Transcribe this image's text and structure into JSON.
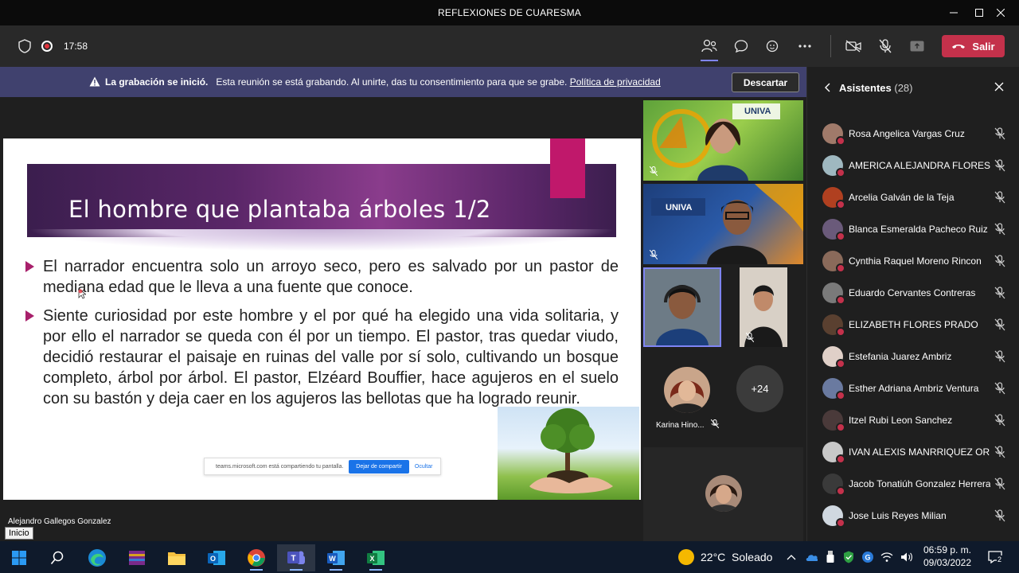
{
  "window": {
    "title": "REFLEXIONES DE CUARESMA",
    "minimize_icon": "minimize-icon",
    "maximize_icon": "maximize-icon",
    "close_icon": "close-icon"
  },
  "toolbar": {
    "timer": "17:58",
    "leave_label": "Salir",
    "colors": {
      "leave": "#c4314b",
      "active": "#7f85f5"
    }
  },
  "banner": {
    "title": "La grabación se inició.",
    "message": "Esta reunión se está grabando. Al unirte, das tu consentimiento para que se grabe.",
    "link": "Política de privacidad",
    "dismiss_label": "Descartar"
  },
  "slide": {
    "title": "El hombre que plantaba árboles 1/2",
    "bullets": [
      "El narrador encuentra solo un arroyo seco, pero es salvado por un pastor de mediana edad que le lleva a una fuente que conoce.",
      "Siente curiosidad por este hombre y el por qué ha elegido una vida solitaria, y por ello el narrador se queda con él por un tiempo. El pastor, tras quedar viudo, decidió restaurar el paisaje en ruinas del valle por sí solo, cultivando un bosque completo, árbol por árbol. El pastor, Elzéard Bouffier, hace agujeros en el suelo con su bastón y deja caer en los agujeros las bellotas que ha logrado reunir."
    ],
    "share_notice": "teams.microsoft.com está compartiendo tu pantalla.",
    "stop_share": "Dejar de compartir",
    "hide": "Ocultar",
    "accent": "#a8206b"
  },
  "presenter": "Alejandro Gallegos Gonzalez",
  "videos": {
    "tile_logo": "UNIVA",
    "small_participant": "Karina Hino...",
    "more_count": "+24"
  },
  "panel": {
    "title": "Asistentes",
    "count": "(28)",
    "attendees": [
      {
        "name": "Rosa Angelica Vargas Cruz",
        "color": "#a07a6a"
      },
      {
        "name": "AMERICA ALEJANDRA FLORES R...",
        "color": "#9fb8c0"
      },
      {
        "name": "Arcelia Galván de la Teja",
        "color": "#b04020"
      },
      {
        "name": "Blanca Esmeralda Pacheco Ruiz",
        "color": "#6a5a7a"
      },
      {
        "name": "Cynthia Raquel Moreno Rincon",
        "color": "#8a6a5a"
      },
      {
        "name": "Eduardo Cervantes Contreras",
        "color": "#7a7a7a"
      },
      {
        "name": "ELIZABETH FLORES PRADO",
        "color": "#5a4030"
      },
      {
        "name": "Estefania Juarez Ambriz",
        "color": "#e0d0c8"
      },
      {
        "name": "Esther Adriana Ambriz Ventura",
        "color": "#6a7aa0"
      },
      {
        "name": "Itzel Rubi Leon Sanchez",
        "color": "#4a3a3a"
      },
      {
        "name": "IVAN ALEXIS MANRRIQUEZ OR...",
        "color": "#c8c8c8"
      },
      {
        "name": "Jacob Tonatiúh Gonzalez Herrera",
        "color": "#3a3a3a"
      },
      {
        "name": "Jose Luis Reyes Milian",
        "color": "#d0d8e0"
      }
    ]
  },
  "taskbar": {
    "tooltip": "Inicio",
    "weather": "22°C  Soleado",
    "time": "06:59 p. m.",
    "date": "09/03/2022",
    "notifications": "2"
  }
}
